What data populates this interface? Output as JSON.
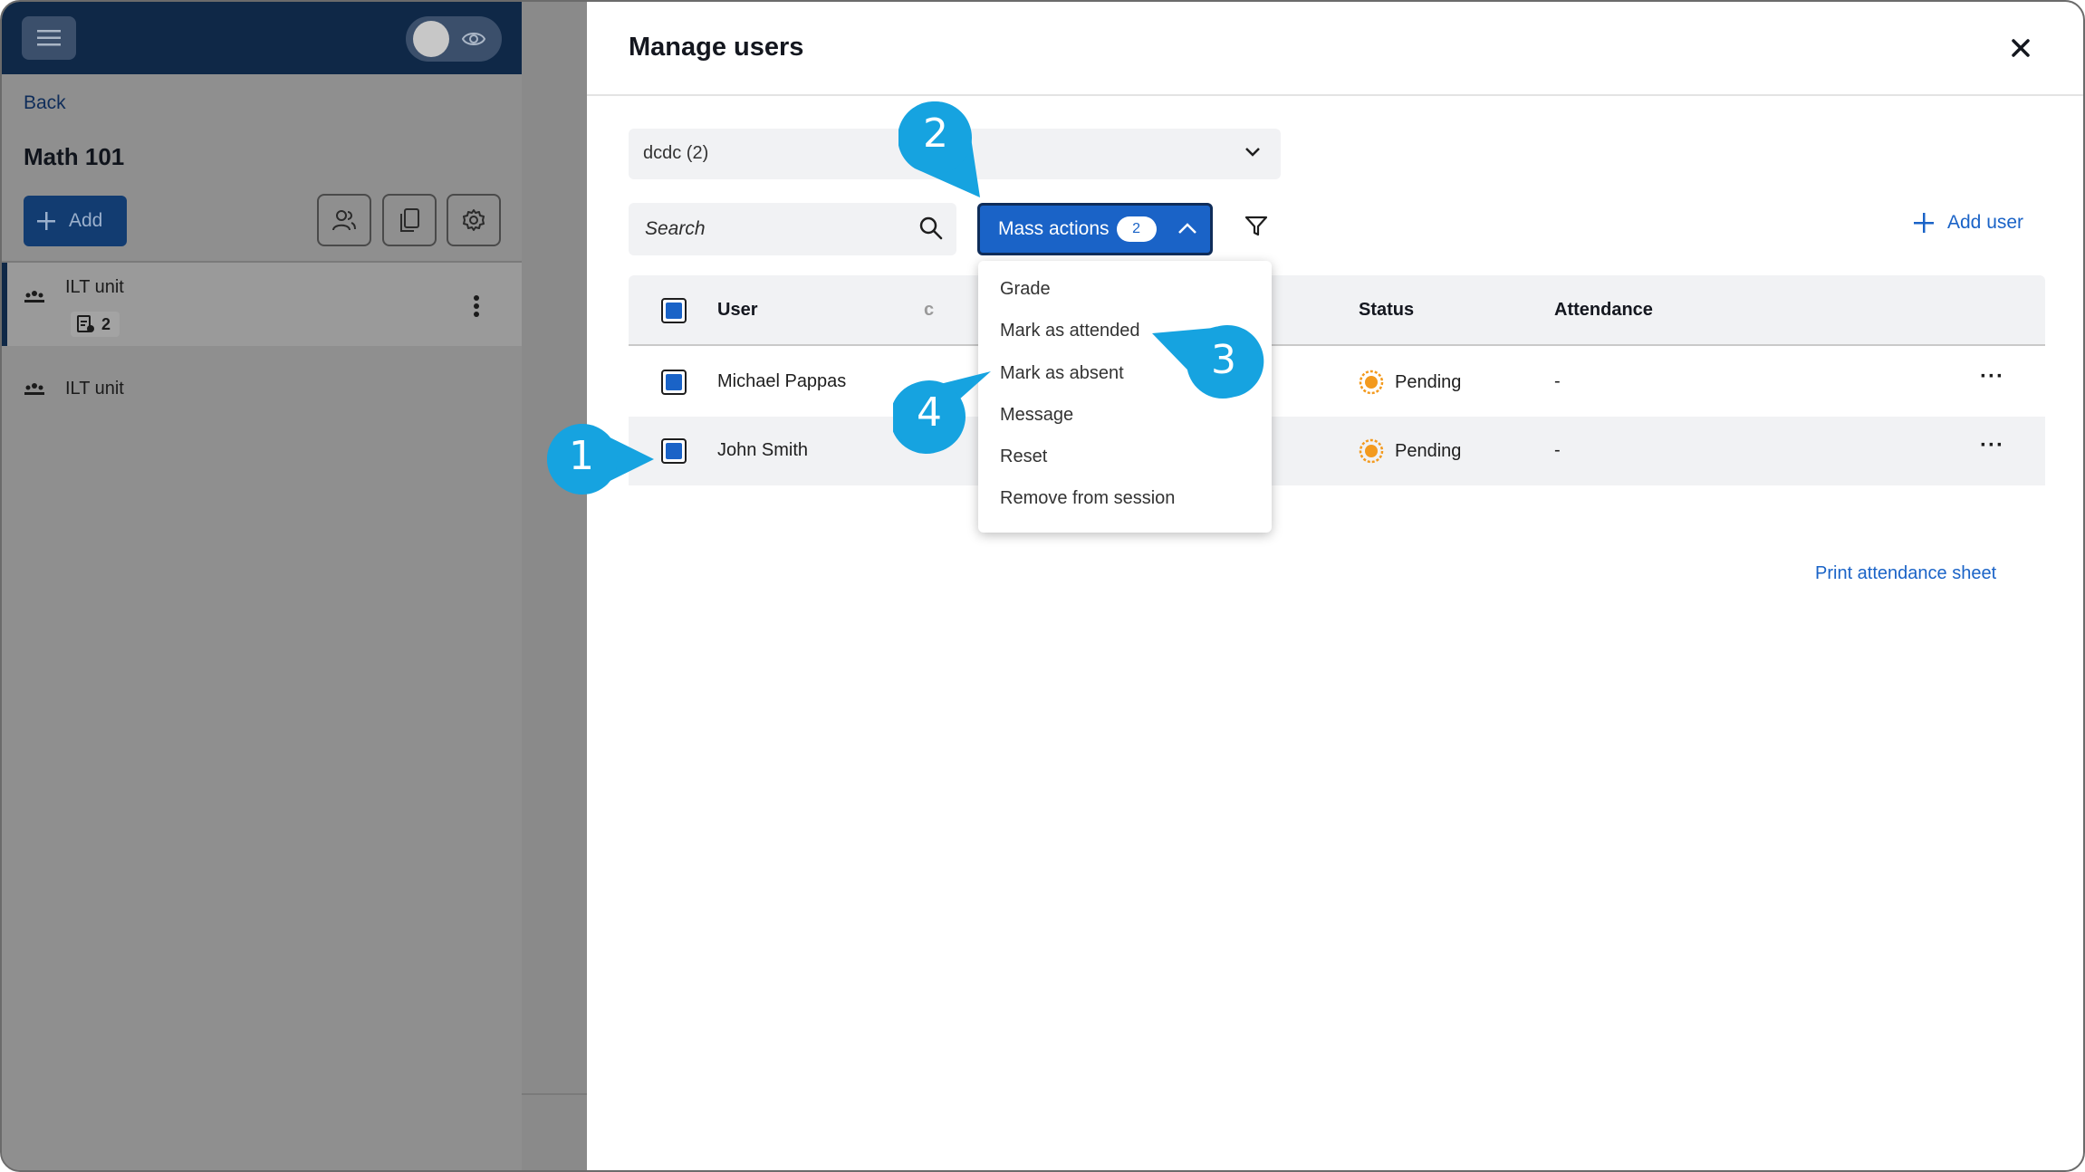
{
  "sidebar": {
    "back_label": "Back",
    "course_title": "Math 101",
    "add_label": "Add",
    "units": [
      {
        "label": "ILT unit",
        "badge_count": "2"
      },
      {
        "label": "ILT unit"
      }
    ]
  },
  "modal": {
    "title": "Manage users",
    "session_select": "dcdc (2)",
    "search_placeholder": "Search",
    "mass_actions_label": "Mass actions",
    "mass_actions_count": "2",
    "add_user_label": "Add user",
    "columns": [
      "User",
      "Status",
      "Attendance"
    ],
    "rows": [
      {
        "user": "Michael Pappas",
        "status": "Pending",
        "attendance": "-"
      },
      {
        "user": "John Smith",
        "status": "Pending",
        "attendance": "-"
      }
    ],
    "mass_actions_menu": [
      "Grade",
      "Mark as attended",
      "Mark as absent",
      "Message",
      "Reset",
      "Remove from session"
    ],
    "print_link": "Print attendance sheet"
  },
  "callouts": [
    "1",
    "2",
    "3",
    "4"
  ],
  "colors": {
    "primary": "#1a63c7",
    "navy": "#0f2847",
    "callout": "#16a3e0",
    "pending": "#f39a1e"
  },
  "icons": [
    "menu-icon",
    "eye-icon",
    "plus-icon",
    "users-icon",
    "copy-icon",
    "gear-icon",
    "group-icon",
    "document-icon",
    "kebab-icon",
    "close-icon",
    "chevron-down-icon",
    "search-icon",
    "chevron-up-icon",
    "filter-icon",
    "pending-icon"
  ]
}
